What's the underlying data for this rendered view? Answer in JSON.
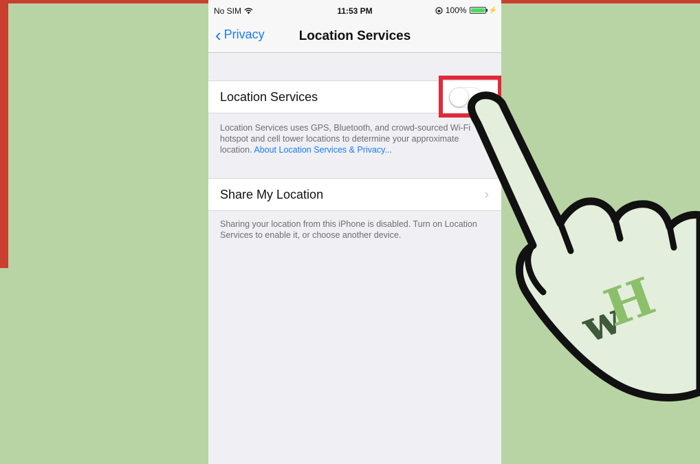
{
  "status_bar": {
    "carrier": "No SIM",
    "time": "11:53 PM",
    "battery": "100%",
    "icons": [
      "wifi-icon",
      "lock-rotation-icon",
      "battery-icon",
      "charging-icon"
    ]
  },
  "nav": {
    "back_label": "Privacy",
    "title": "Location Services"
  },
  "location_services": {
    "label": "Location Services",
    "toggle_on": false,
    "footer_text": "Location Services uses GPS, Bluetooth, and crowd-sourced Wi-Fi hotspot and cell tower locations to determine your approximate location.",
    "footer_link": "About Location Services & Privacy..."
  },
  "share_my_location": {
    "label": "Share My Location",
    "footer_text": "Sharing your location from this iPhone is disabled. Turn on Location Services to enable it, or choose another device."
  },
  "overlay": {
    "logo_text": "wH",
    "colors": {
      "background": "#b8d4a4",
      "highlight": "#e02a3b",
      "accent": "#c9402e",
      "link": "#1a7cf3",
      "logo_dark": "#3e5a3a",
      "logo_light": "#8cbf6a"
    }
  }
}
